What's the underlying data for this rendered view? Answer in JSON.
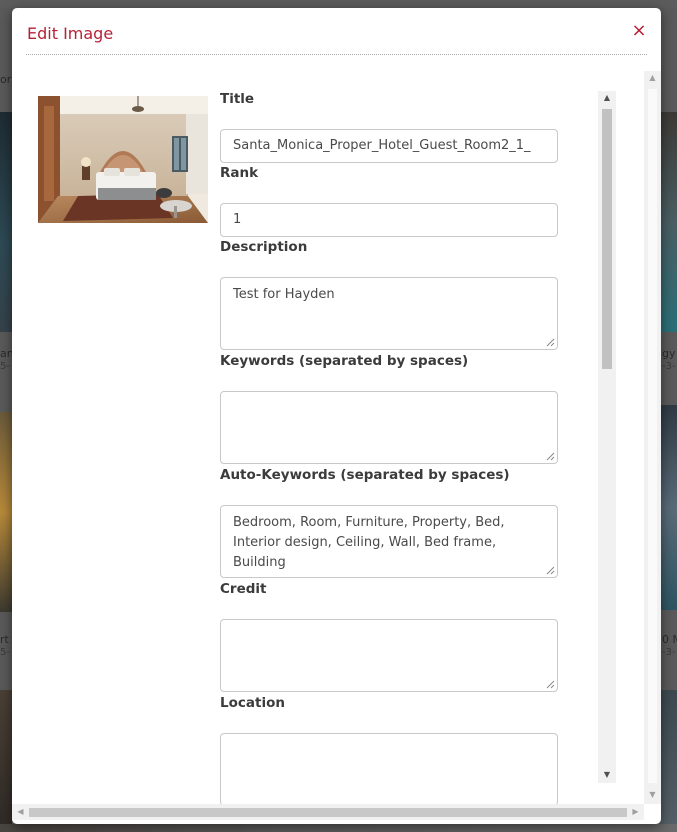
{
  "modal": {
    "title": "Edit Image",
    "close_label": "×"
  },
  "image": {
    "alt": "Hotel guest room with bed"
  },
  "fields": {
    "title": {
      "label": "Title",
      "value": "Santa_Monica_Proper_Hotel_Guest_Room2_1_"
    },
    "rank": {
      "label": "Rank",
      "value": "1"
    },
    "description": {
      "label": "Description",
      "value": "Test for Hayden"
    },
    "keywords": {
      "label": "Keywords (separated by spaces)",
      "value": ""
    },
    "auto_keywords": {
      "label": "Auto-Keywords (separated by spaces)",
      "value": "Bedroom, Room, Furniture, Property, Bed, Interior design, Ceiling, Wall, Bed frame, Building"
    },
    "credit": {
      "label": "Credit",
      "value": ""
    },
    "location": {
      "label": "Location",
      "value": ""
    }
  },
  "background": {
    "snippets": [
      "ori",
      "an",
      "5-",
      "rt",
      "5-",
      "gy",
      "-3-",
      "0 M",
      "-3-"
    ]
  },
  "colors": {
    "accent": "#b52236",
    "label": "#3b3b3b",
    "input_border": "#c8c8c8"
  },
  "icons": {
    "close": "close-icon",
    "scroll_up": "arrow-up-icon",
    "scroll_down": "arrow-down-icon",
    "scroll_left": "arrow-left-icon",
    "scroll_right": "arrow-right-icon",
    "resize": "resize-grip-icon"
  }
}
